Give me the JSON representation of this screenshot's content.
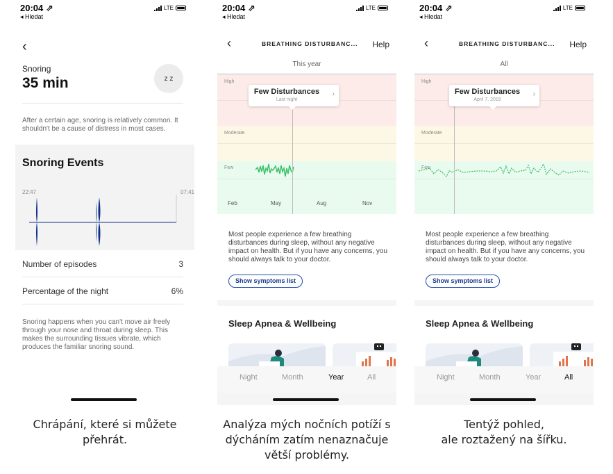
{
  "status": {
    "time": "20:04 ⇗",
    "back_app": "◂ Hledat",
    "network": "LTE"
  },
  "screen1": {
    "back_icon": "chevron-left",
    "label": "Snoring",
    "value": "35 min",
    "zz_icon": "zzz-icon",
    "zz_text": "z z",
    "note": "After a certain age, snoring is relatively common. It shouldn't be a cause of distress in most cases.",
    "events_title": "Snoring Events",
    "time_start": "22:47",
    "time_end": "07:41",
    "stats": [
      {
        "label": "Number of episodes",
        "value": "3"
      },
      {
        "label": "Percentage of the night",
        "value": "6%"
      }
    ],
    "footer_note": "Snoring happens when you can't move air freely through your nose and throat during sleep. This makes the surrounding tissues vibrate, which produces the familiar snoring sound."
  },
  "screen2": {
    "title": "BREATHING DISTURBANC...",
    "help": "Help",
    "period": "This year",
    "zones": {
      "high": "High",
      "moderate": "Moderate",
      "few": "Few"
    },
    "months": [
      "Feb",
      "May",
      "Aug",
      "Nov"
    ],
    "tooltip_title": "Few Disturbances",
    "tooltip_sub": "Last night",
    "info_text": "Most people experience a few breathing disturbances during sleep, without any negative impact on health. But if you have any concerns, you should always talk to your doctor.",
    "button": "Show symptoms list",
    "section_title": "Sleep Apnea & Wellbeing",
    "tabs": [
      "Night",
      "Month",
      "Year",
      "All"
    ],
    "active_tab": "Year"
  },
  "screen3": {
    "title": "BREATHING DISTURBANC...",
    "help": "Help",
    "period": "All",
    "zones": {
      "high": "High",
      "moderate": "Moderate",
      "few": "Few"
    },
    "tooltip_title": "Few Disturbances",
    "tooltip_sub": "April 7, 2019",
    "info_text": "Most people experience a few breathing disturbances during sleep, without any negative impact on health. But if you have any concerns, you should always talk to your doctor.",
    "button": "Show symptoms list",
    "section_title": "Sleep Apnea & Wellbeing",
    "tabs": [
      "Night",
      "Month",
      "Year",
      "All"
    ],
    "active_tab": "All"
  },
  "captions": [
    "Chrápání, které si můžete\npřehrát.",
    "Analýza mých nočních potíží s\ndýcháním zatím nenaznačuje\nvětší problémy.",
    "Tentýž pohled,\nale roztažený na šířku."
  ],
  "colors": {
    "accent": "#1a3c8c",
    "trend": "#3cc06a",
    "snore": "#0d2f8c"
  }
}
